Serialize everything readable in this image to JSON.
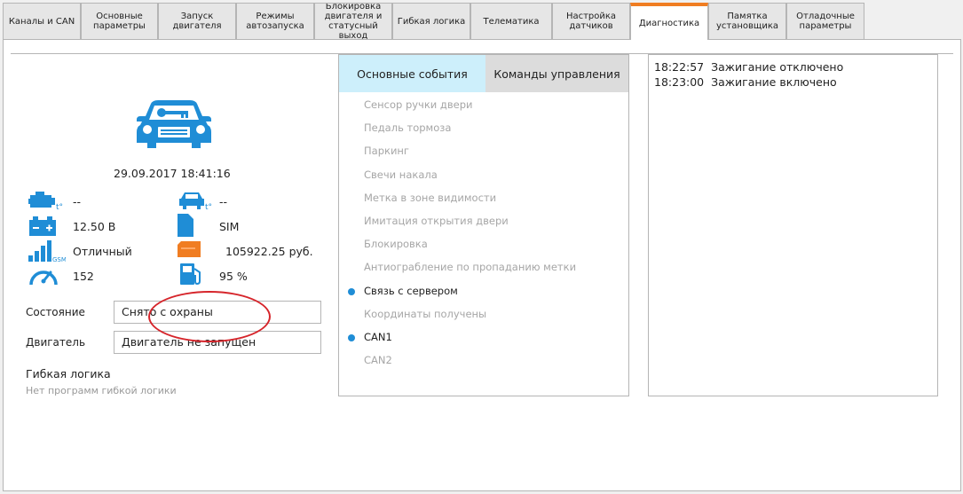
{
  "tabs": [
    {
      "label": "Каналы и CAN",
      "active": false
    },
    {
      "label": "Основные\nпараметры",
      "active": false
    },
    {
      "label": "Запуск\nдвигателя",
      "active": false
    },
    {
      "label": "Режимы\nавтозапуска",
      "active": false
    },
    {
      "label": "Блокировка\nдвигателя и\nстатусный\nвыход",
      "active": false
    },
    {
      "label": "Гибкая логика",
      "active": false
    },
    {
      "label": "Телематика",
      "active": false
    },
    {
      "label": "Настройка\nдатчиков",
      "active": false
    },
    {
      "label": "Диагностика",
      "active": true
    },
    {
      "label": "Памятка\nустановщика",
      "active": false
    },
    {
      "label": "Отладочные\nпараметры",
      "active": false
    }
  ],
  "status": {
    "datetime": "29.09.2017  18:41:16",
    "engine_temp": "--",
    "cabin_temp": "--",
    "voltage": "12.50 В",
    "sim": "SIM",
    "gsm_signal": "Отличный",
    "balance": "105922.25 руб.",
    "speed": "152",
    "fuel": "95 %"
  },
  "fields": {
    "state_label": "Состояние",
    "state_value": "Снято с охраны",
    "engine_label": "Двигатель",
    "engine_value": "Двигатель не запущен"
  },
  "flex_logic": {
    "title": "Гибкая логика",
    "subtitle": "Нет программ гибкой логики"
  },
  "events": {
    "tab_main": "Основные события",
    "tab_commands": "Команды управления",
    "items": [
      {
        "label": "Сенсор ручки двери",
        "active": false
      },
      {
        "label": "Педаль тормоза",
        "active": false
      },
      {
        "label": "Паркинг",
        "active": false
      },
      {
        "label": "Свечи накала",
        "active": false
      },
      {
        "label": "Метка в зоне видимости",
        "active": false
      },
      {
        "label": "Имитация открытия двери",
        "active": false
      },
      {
        "label": "Блокировка",
        "active": false
      },
      {
        "label": "Антиограбление по пропаданию метки",
        "active": false
      },
      {
        "label": "Связь с сервером",
        "active": true
      },
      {
        "label": "Координаты получены",
        "active": false
      },
      {
        "label": "CAN1",
        "active": true
      },
      {
        "label": "CAN2",
        "active": false
      }
    ]
  },
  "log": [
    "18:22:57  Зажигание отключено",
    "18:23:00  Зажигание включено"
  ],
  "colors": {
    "accent": "#1f8dd6",
    "active_tab": "#f07d22",
    "annotation": "#d6252b",
    "events_tab_on": "#cdeffb"
  }
}
